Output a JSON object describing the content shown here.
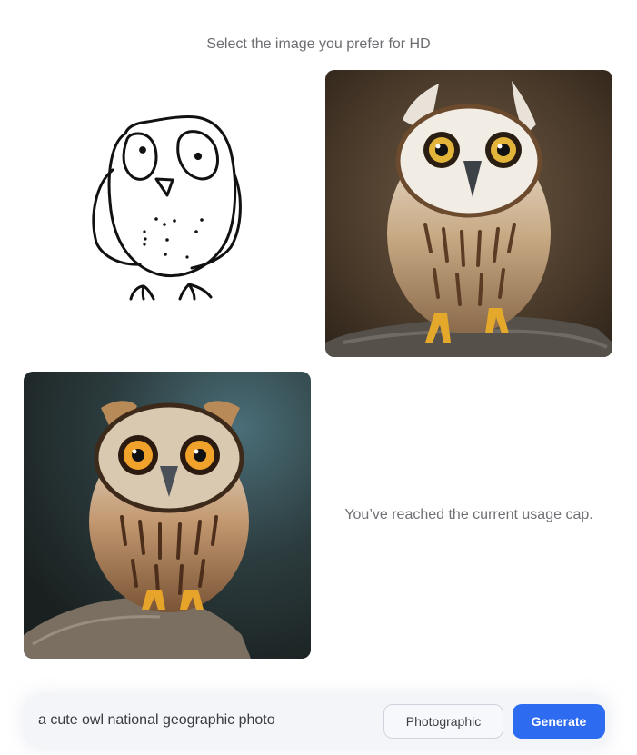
{
  "header": {
    "title": "Select the image you prefer for HD"
  },
  "images": [
    {
      "kind": "sketch",
      "icon": "owl-sketch-icon"
    },
    {
      "kind": "photo",
      "icon": "owl-photo-icon"
    },
    {
      "kind": "photo",
      "icon": "owl-photo-icon"
    }
  ],
  "status": {
    "usage_cap_message": "You’ve reached the current usage cap."
  },
  "prompt_bar": {
    "prompt_value": "a cute owl national geographic photo",
    "style_label": "Photographic",
    "generate_label": "Generate"
  },
  "colors": {
    "accent": "#2d6bf0",
    "background": "#ffffff",
    "prompt_bar_bg": "#f4f5f9"
  }
}
